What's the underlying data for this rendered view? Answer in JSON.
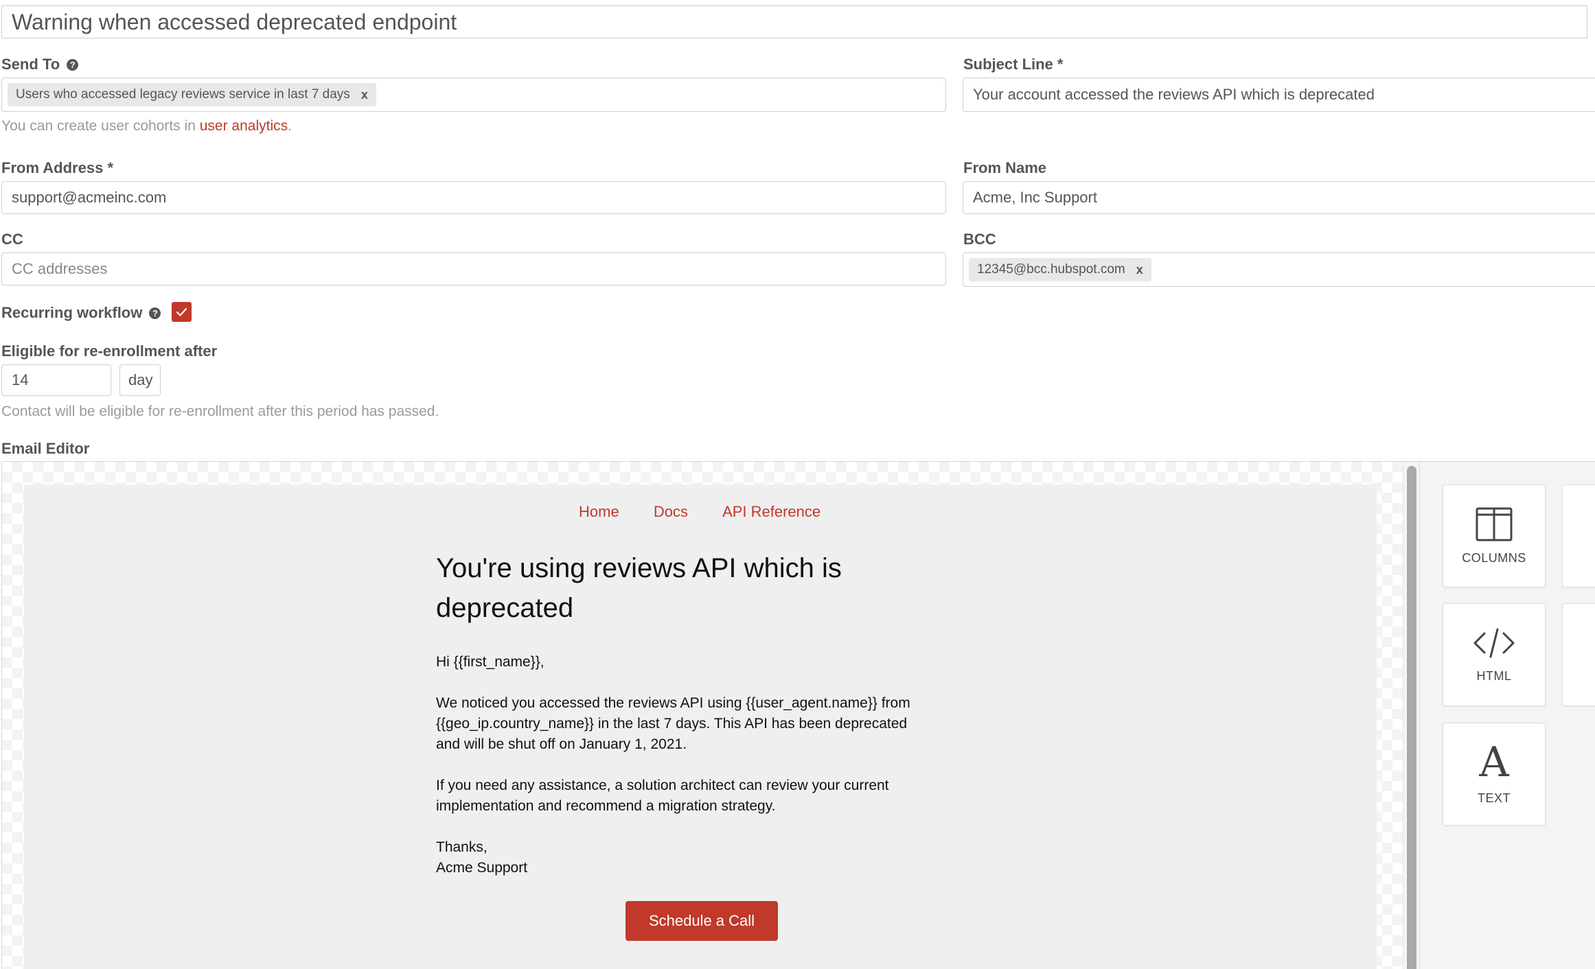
{
  "title_value": "Warning when accessed deprecated endpoint",
  "send_to": {
    "label": "Send To",
    "chip": "Users who accessed legacy reviews service in last 7 days",
    "chip_remove": "x",
    "hint_prefix": "You can create user cohorts in ",
    "hint_link": "user analytics",
    "hint_suffix": "."
  },
  "subject": {
    "label": "Subject Line *",
    "value": "Your account accessed the reviews API which is deprecated"
  },
  "from_address": {
    "label": "From Address *",
    "value": "support@acmeinc.com"
  },
  "from_name": {
    "label": "From Name",
    "value": "Acme, Inc Support"
  },
  "cc": {
    "label": "CC",
    "placeholder": "CC addresses"
  },
  "bcc": {
    "label": "BCC",
    "chip": "12345@bcc.hubspot.com",
    "chip_remove": "x"
  },
  "recurring": {
    "label": "Recurring workflow",
    "checked": true
  },
  "reenroll": {
    "label": "Eligible for re-enrollment after",
    "value": "14",
    "unit": "day",
    "hint": "Contact will be eligible for re-enrollment after this period has passed."
  },
  "editor": {
    "label": "Email Editor",
    "nav": [
      "Home",
      "Docs",
      "API Reference"
    ],
    "heading_line1": "You're using reviews API which is",
    "heading_line2": "deprecated",
    "greeting": "Hi {{first_name}},",
    "p1_line1": "We noticed you accessed the reviews API using {{user_agent.name}} from",
    "p1_line2": "{{geo_ip.country_name}} in the last 7 days. This API has been deprecated",
    "p1_line3": "and will be shut off on January 1, 2021.",
    "p2_line1": "If you need any assistance, a solution architect can review your current",
    "p2_line2": "implementation and recommend a migration strategy.",
    "signoff1": "Thanks,",
    "signoff2": "Acme Support",
    "cta": "Schedule a Call"
  },
  "blocks": [
    {
      "label": "COLUMNS",
      "icon": "columns-icon"
    },
    {
      "label": "HTML",
      "icon": "code-icon"
    },
    {
      "label": "TEXT",
      "icon": "text-icon"
    }
  ],
  "colors": {
    "accent": "#c0392b",
    "canvas": "#efefef",
    "label": "#555555"
  }
}
